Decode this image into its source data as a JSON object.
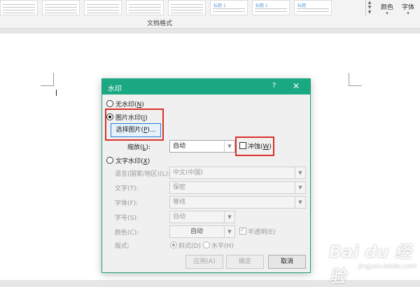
{
  "ribbon": {
    "thumbnails": [
      {
        "heading": ""
      },
      {
        "heading": ""
      },
      {
        "heading": ""
      },
      {
        "heading": ""
      },
      {
        "heading": ""
      },
      {
        "heading": "标题 1"
      },
      {
        "heading": "标题 1"
      },
      {
        "heading": "标题"
      }
    ],
    "group_label": "文档格式",
    "colors_label": "颜色",
    "fonts_label": "字体"
  },
  "dialog": {
    "title": "水印",
    "help": "?",
    "close": "✕",
    "no_watermark": {
      "text": "无水印(",
      "key": "N",
      "end": ")",
      "selected": false
    },
    "picture_watermark": {
      "text": "图片水印(",
      "key": "I",
      "end": ")",
      "selected": true
    },
    "select_picture": {
      "text": "选择图片(",
      "key": "P",
      "end": ")..."
    },
    "scale": {
      "text": "缩放(",
      "key": "L",
      "end": "):",
      "value": "自动"
    },
    "washout": {
      "text": "冲蚀(",
      "key": "W",
      "end": ")",
      "checked": false
    },
    "text_watermark": {
      "text": "文字水印(",
      "key": "X",
      "end": ")",
      "selected": false
    },
    "language": {
      "label": "语言(国家/地区)(L):",
      "value": "中文(中国)"
    },
    "text": {
      "label": "文字(T):",
      "value": "保密"
    },
    "font": {
      "label": "字体(F):",
      "value": "等线"
    },
    "size": {
      "label": "字号(S):",
      "value": "自动"
    },
    "color": {
      "label": "颜色(C):",
      "value": "自动",
      "semi_transparent": "半透明(E)",
      "semi_transparent_checked": true
    },
    "layout": {
      "label": "版式:",
      "diagonal": "斜式(D)",
      "horizontal": "水平(H)",
      "selected": "diagonal"
    },
    "apply": "应用(A)",
    "ok": "确定",
    "cancel": "取消"
  },
  "watermark": {
    "logo": "Bai du 经验",
    "url": "jingyan.baidu.com"
  },
  "colors": {
    "accent": "#1aa882",
    "highlight": "#d9302b",
    "focus": "#2b7bd2"
  }
}
